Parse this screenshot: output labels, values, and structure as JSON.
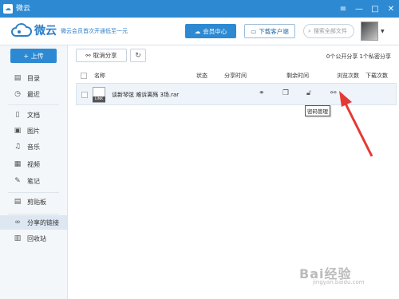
{
  "titlebar": {
    "logo_icon": "cloud-icon",
    "title": "微云"
  },
  "header": {
    "brand_name": "微云",
    "promo": "微云会员首次开通低至一元",
    "vip_label": "会员中心",
    "download_label": "下载客户端",
    "search_placeholder": "搜索全部文件",
    "accent": "#2d8ad2"
  },
  "sidebar": {
    "upload_label": "+ 上传",
    "items": [
      {
        "label": "目录",
        "icon": "folder-list-icon"
      },
      {
        "label": "最近",
        "icon": "clock-icon"
      },
      {
        "label": "文档",
        "icon": "document-icon"
      },
      {
        "label": "图片",
        "icon": "image-icon"
      },
      {
        "label": "音乐",
        "icon": "music-icon"
      },
      {
        "label": "视频",
        "icon": "video-icon"
      },
      {
        "label": "笔记",
        "icon": "note-icon"
      },
      {
        "label": "剪贴板",
        "icon": "clipboard-icon"
      },
      {
        "label": "分享的链接",
        "icon": "link-icon",
        "active": true
      },
      {
        "label": "回收站",
        "icon": "trash-icon"
      }
    ]
  },
  "toolbar": {
    "cancel_share_label": "取消分享",
    "stats": "0个公开分享  1个私密分享"
  },
  "table": {
    "headers": [
      "名称",
      "状态",
      "分享时间",
      "剩余时间",
      "浏览次数",
      "下载次数"
    ],
    "rows": [
      {
        "name": "谈新琴弦 难诉离殇 3场.rar",
        "file_tag": "LINK"
      }
    ]
  },
  "tooltip": "密码管理",
  "watermark": {
    "text": "Bai经验",
    "sub": "jingyan.baidu.com"
  }
}
